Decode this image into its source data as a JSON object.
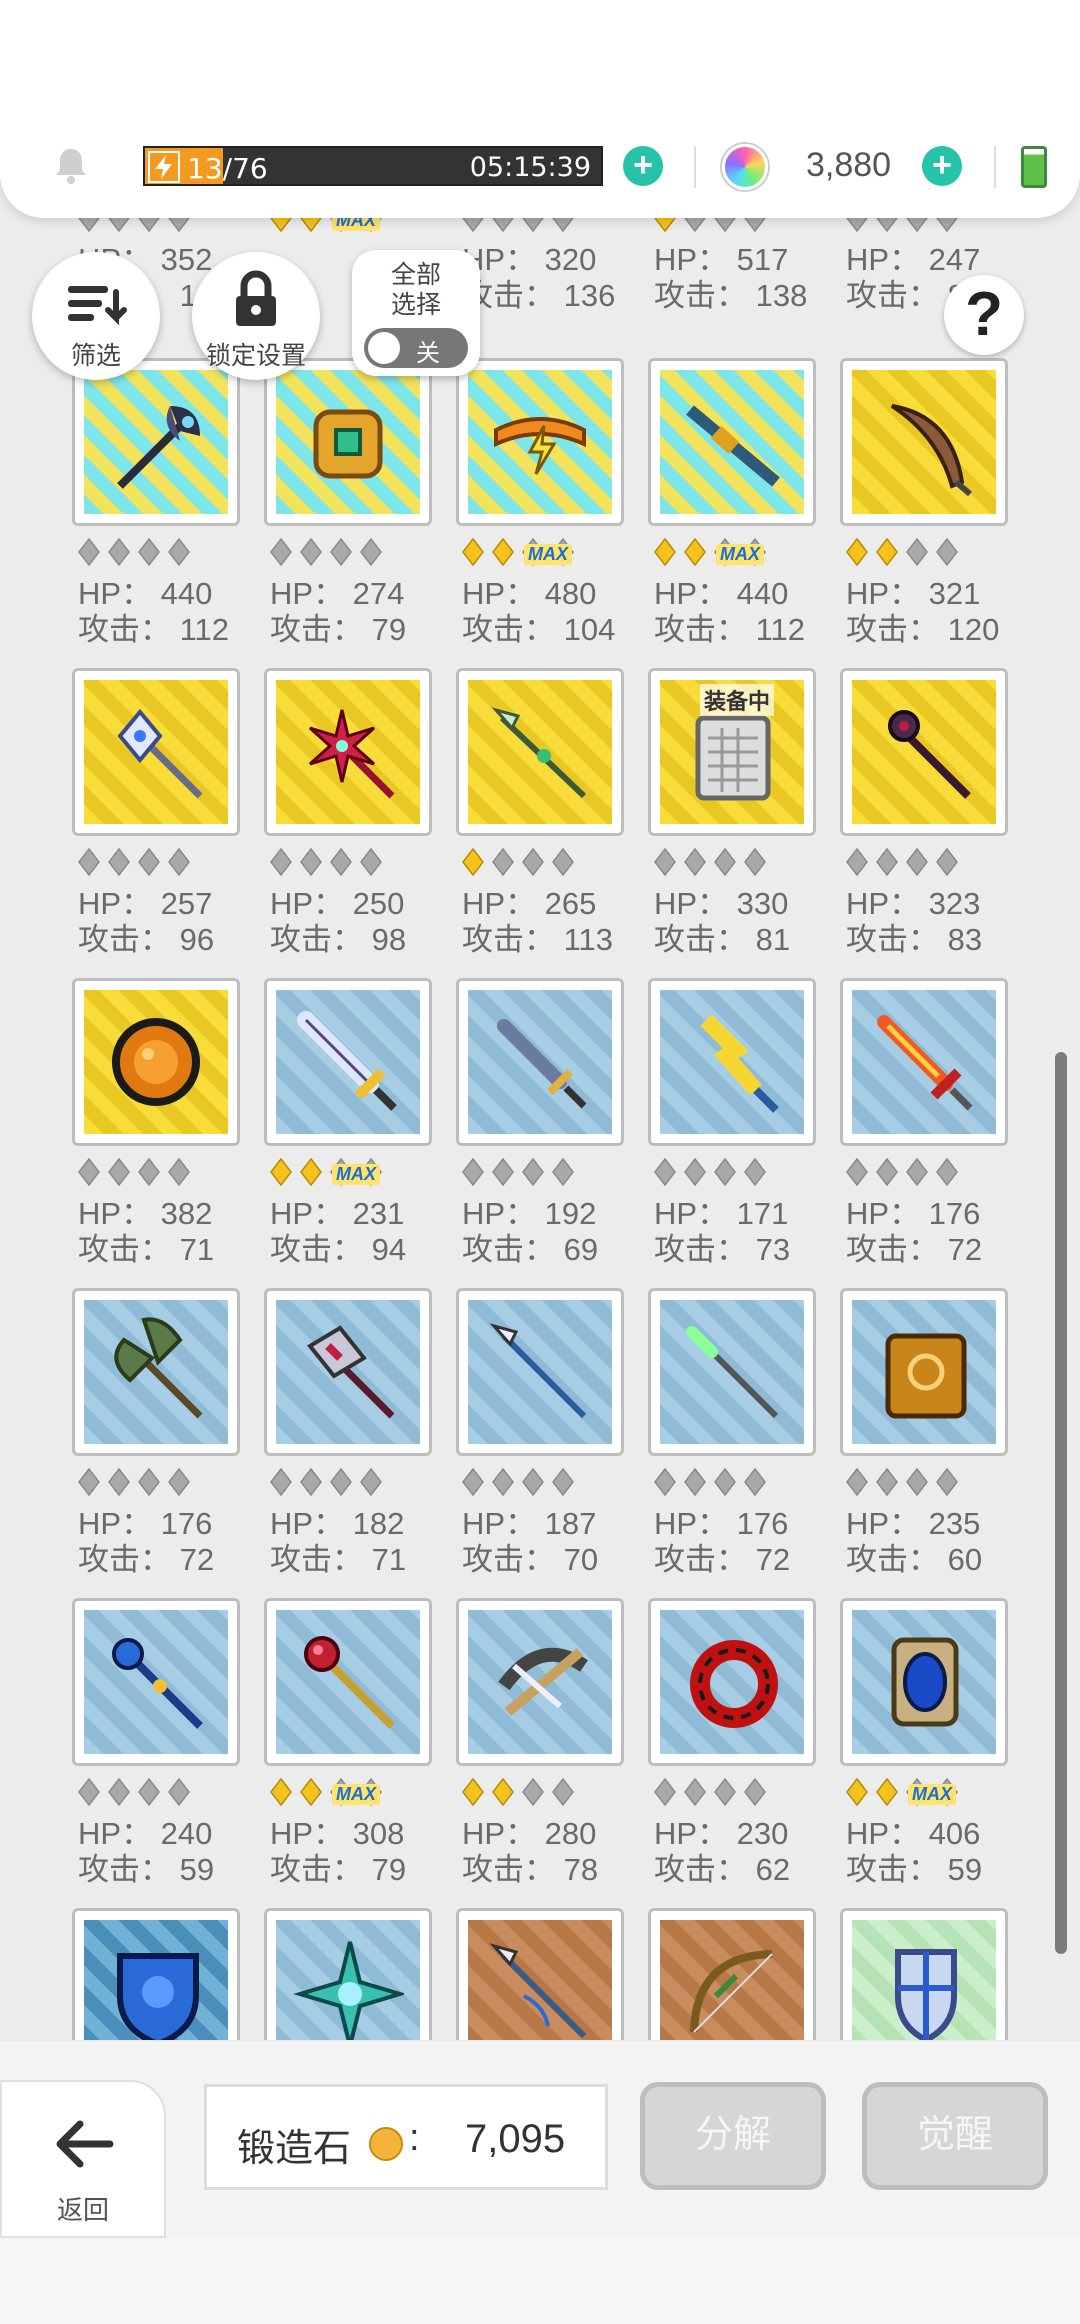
{
  "status": {
    "energy_current": "13",
    "energy_max": "/76",
    "energy_timer": "05:15:39",
    "gems": "3,880"
  },
  "toolbar": {
    "filter_label": "筛选",
    "lock_label": "锁定设置",
    "select_all_label": "全部\n选择",
    "toggle_label": "关",
    "help_label": "?"
  },
  "partial_row": [
    {
      "hp": "352",
      "atk": "1"
    },
    {
      "hp": "",
      "atk": ""
    },
    {
      "hp": "320",
      "atk": "136"
    },
    {
      "hp": "517",
      "atk": "138"
    },
    {
      "hp": "247",
      "atk": "8"
    }
  ],
  "stat_labels": {
    "hp": "HP：",
    "atk": "攻击："
  },
  "equipped_label": "装备中",
  "max_label": "MAX",
  "items": [
    {
      "hp": "440",
      "atk": "112",
      "stars": 0,
      "max": false,
      "bg": "cyan",
      "icon": "dark-axe-icon"
    },
    {
      "hp": "274",
      "atk": "79",
      "stars": 0,
      "max": false,
      "bg": "cyan",
      "icon": "gold-gauntlet-icon"
    },
    {
      "hp": "480",
      "atk": "104",
      "stars": 2,
      "max": true,
      "bg": "cyan",
      "icon": "lightning-belt-icon"
    },
    {
      "hp": "440",
      "atk": "112",
      "stars": 2,
      "max": true,
      "bg": "cyan",
      "icon": "rifle-icon"
    },
    {
      "hp": "321",
      "atk": "120",
      "stars": 2,
      "max": false,
      "bg": "gold",
      "icon": "feather-quill-icon"
    },
    {
      "hp": "257",
      "atk": "96",
      "stars": 0,
      "max": false,
      "bg": "gold",
      "icon": "crystal-halberd-icon"
    },
    {
      "hp": "250",
      "atk": "98",
      "stars": 0,
      "max": false,
      "bg": "gold",
      "icon": "star-wand-icon"
    },
    {
      "hp": "265",
      "atk": "113",
      "stars": 1,
      "max": false,
      "bg": "gold",
      "icon": "jade-spear-icon"
    },
    {
      "hp": "330",
      "atk": "81",
      "stars": 0,
      "max": false,
      "bg": "gold",
      "icon": "tome-icon",
      "equipped": true
    },
    {
      "hp": "323",
      "atk": "83",
      "stars": 0,
      "max": false,
      "bg": "gold",
      "icon": "dark-staff-icon"
    },
    {
      "hp": "382",
      "atk": "71",
      "stars": 0,
      "max": false,
      "bg": "gold",
      "icon": "amber-orb-icon"
    },
    {
      "hp": "231",
      "atk": "94",
      "stars": 2,
      "max": true,
      "bg": "blue",
      "icon": "broadsword-icon"
    },
    {
      "hp": "192",
      "atk": "69",
      "stars": 0,
      "max": false,
      "bg": "blue",
      "icon": "dagger-icon"
    },
    {
      "hp": "171",
      "atk": "73",
      "stars": 0,
      "max": false,
      "bg": "blue",
      "icon": "lightning-sword-icon"
    },
    {
      "hp": "176",
      "atk": "72",
      "stars": 0,
      "max": false,
      "bg": "blue",
      "icon": "flame-sword-icon"
    },
    {
      "hp": "176",
      "atk": "72",
      "stars": 0,
      "max": false,
      "bg": "blue",
      "icon": "battle-axe-icon"
    },
    {
      "hp": "182",
      "atk": "71",
      "stars": 0,
      "max": false,
      "bg": "blue",
      "icon": "crimson-axe-icon"
    },
    {
      "hp": "187",
      "atk": "70",
      "stars": 0,
      "max": false,
      "bg": "blue",
      "icon": "steel-spear-icon"
    },
    {
      "hp": "176",
      "atk": "72",
      "stars": 0,
      "max": false,
      "bg": "blue",
      "icon": "green-wand-icon"
    },
    {
      "hp": "235",
      "atk": "60",
      "stars": 0,
      "max": false,
      "bg": "blue",
      "icon": "spellbook-icon"
    },
    {
      "hp": "240",
      "atk": "59",
      "stars": 0,
      "max": false,
      "bg": "blue",
      "icon": "blue-scepter-icon"
    },
    {
      "hp": "308",
      "atk": "79",
      "stars": 2,
      "max": true,
      "bg": "blue",
      "icon": "ruby-scepter-icon"
    },
    {
      "hp": "280",
      "atk": "78",
      "stars": 2,
      "max": false,
      "bg": "blue",
      "icon": "crossbow-icon"
    },
    {
      "hp": "230",
      "atk": "62",
      "stars": 0,
      "max": false,
      "bg": "blue",
      "icon": "red-ring-icon"
    },
    {
      "hp": "406",
      "atk": "59",
      "stars": 2,
      "max": true,
      "bg": "blue",
      "icon": "mirror-icon"
    },
    {
      "hp": "",
      "atk": "",
      "stars": 0,
      "max": false,
      "bg": "dblue",
      "icon": "blue-shield-icon"
    },
    {
      "hp": "",
      "atk": "",
      "stars": 0,
      "max": false,
      "bg": "blue",
      "icon": "teal-emblem-icon"
    },
    {
      "hp": "",
      "atk": "",
      "stars": 0,
      "max": false,
      "bg": "brown",
      "icon": "lance-icon"
    },
    {
      "hp": "",
      "atk": "",
      "stars": 0,
      "max": false,
      "bg": "brown",
      "icon": "longbow-icon"
    },
    {
      "hp": "",
      "atk": "",
      "stars": 0,
      "max": false,
      "bg": "green",
      "icon": "kite-shield-icon"
    }
  ],
  "bottom": {
    "back_label": "返回",
    "stone_label": "锻造石",
    "stone_colon": ":",
    "stone_value": "7,095",
    "dismantle_label": "分解",
    "awaken_label": "觉醒"
  },
  "colors": {
    "accent": "#27c3a8",
    "energy": "#f39a1f",
    "star_gold": "#f8c21c",
    "star_grey": "#a9a9a9"
  }
}
